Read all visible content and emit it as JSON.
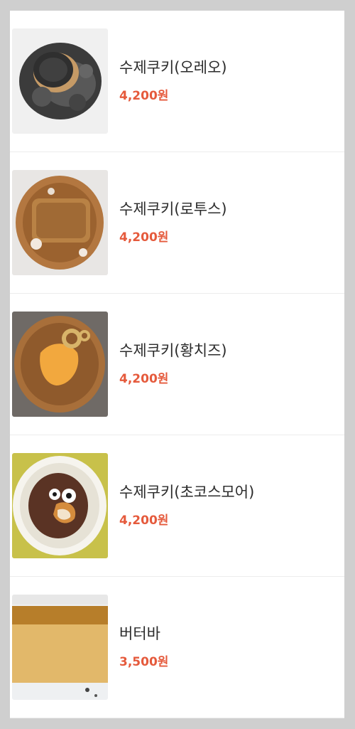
{
  "menu": {
    "items": [
      {
        "name": "수제쿠키(오레오)",
        "price": "4,200원",
        "image": "oreo-cookie-photo"
      },
      {
        "name": "수제쿠키(로투스)",
        "price": "4,200원",
        "image": "lotus-cookie-photo"
      },
      {
        "name": "수제쿠키(황치즈)",
        "price": "4,200원",
        "image": "yellow-cheese-cookie-photo"
      },
      {
        "name": "수제쿠키(초코스모어)",
        "price": "4,200원",
        "image": "choco-smore-cookie-photo"
      },
      {
        "name": "버터바",
        "price": "3,500원",
        "image": "butter-bar-photo"
      }
    ]
  },
  "colors": {
    "price": "#e55a3c",
    "name": "#2b2b2b",
    "frame": "#cfcfcf",
    "card": "#ffffff"
  }
}
